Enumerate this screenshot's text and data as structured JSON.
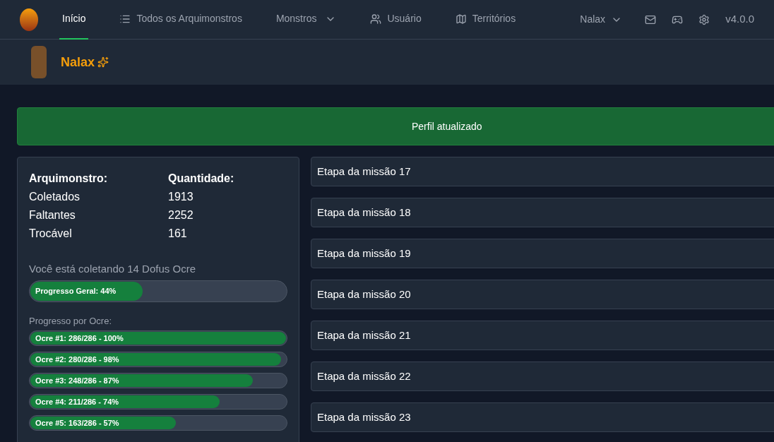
{
  "nav": {
    "items": [
      {
        "label": "Início",
        "kind": "plain",
        "selected": true
      },
      {
        "label": "Todos os Arquimonstros",
        "kind": "list",
        "selected": false
      },
      {
        "label": "Monstros",
        "kind": "dropdown",
        "selected": false
      },
      {
        "label": "Usuário",
        "kind": "users",
        "selected": false
      },
      {
        "label": "Territórios",
        "kind": "map",
        "selected": false
      }
    ],
    "user_menu": "Nalax",
    "version": "v4.0.0"
  },
  "profile": {
    "name": "Nalax"
  },
  "alert": "Perfil atualizado",
  "stats": {
    "columns": [
      "Arquimonstro:",
      "Quantidade:"
    ],
    "rows": [
      [
        "Coletados",
        "1913"
      ],
      [
        "Faltantes",
        "2252"
      ],
      [
        "Trocável",
        "161"
      ]
    ]
  },
  "collecting": "Você está coletando 14 Dofus Ocre",
  "overall": {
    "label": "Progresso Geral: 44%",
    "level": 0.44
  },
  "per_ocre_title": "Progresso por Ocre:",
  "ocres": [
    {
      "label": "Ocre #1: 286/286 - 100%",
      "level": 1
    },
    {
      "label": "Ocre #2: 280/286 - 98%",
      "level": 0.98
    },
    {
      "label": "Ocre #3: 248/286 - 87%",
      "level": 0.87
    },
    {
      "label": "Ocre #4: 211/286 - 74%",
      "level": 0.74
    },
    {
      "label": "Ocre #5: 163/286 - 57%",
      "level": 0.57
    }
  ],
  "steps": [
    "Etapa da missão 17",
    "Etapa da missão 18",
    "Etapa da missão 19",
    "Etapa da missão 20",
    "Etapa da missão 21",
    "Etapa da missão 22",
    "Etapa da missão 23"
  ]
}
